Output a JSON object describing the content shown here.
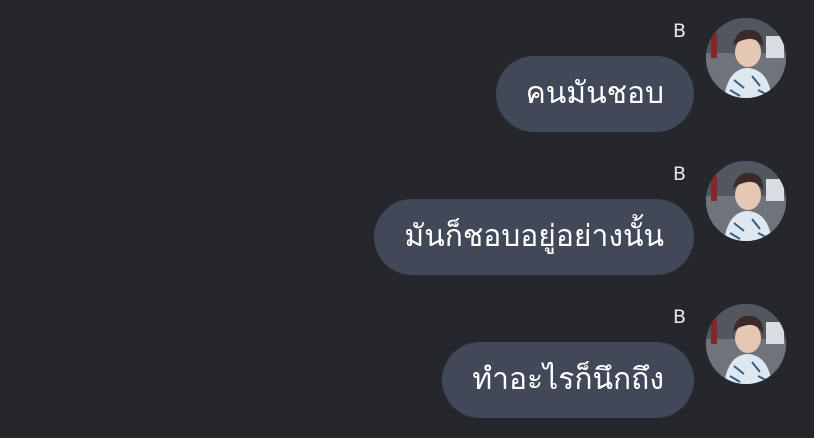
{
  "messages": [
    {
      "sender": "B",
      "text": "คนมันชอบ",
      "avatar_icon": "profile-photo"
    },
    {
      "sender": "B",
      "text": "มันก็ชอบอยู่อย่างนั้น",
      "avatar_icon": "profile-photo"
    },
    {
      "sender": "B",
      "text": "ทำอะไรก็นึกถึง",
      "avatar_icon": "profile-photo"
    }
  ],
  "colors": {
    "background": "#25272d",
    "bubble": "#414959",
    "text": "#ffffff"
  }
}
